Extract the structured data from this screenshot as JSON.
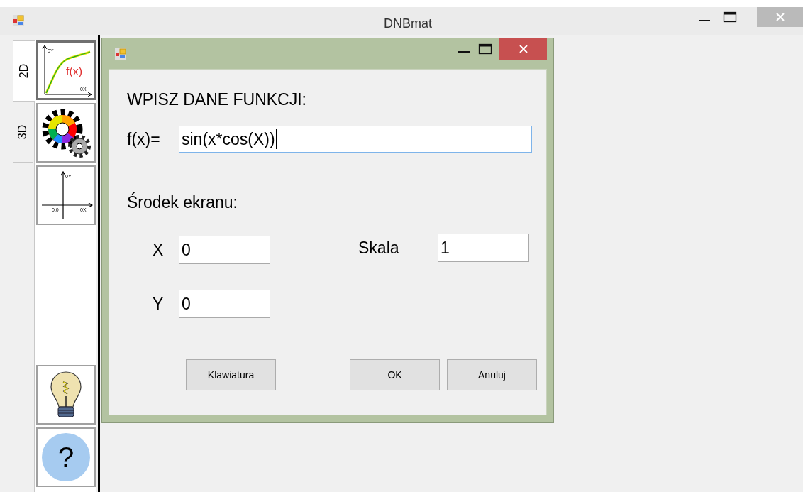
{
  "window": {
    "title": "DNBmat"
  },
  "side_tabs": [
    {
      "label": "2D",
      "selected": true
    },
    {
      "label": "3D",
      "selected": false
    }
  ],
  "tool_buttons": [
    {
      "kind": "graph",
      "selected": true,
      "labels": [
        "0Y",
        "f(x)",
        "0X"
      ]
    },
    {
      "kind": "gears",
      "selected": false
    },
    {
      "kind": "axes",
      "selected": false,
      "labels": [
        "0Y",
        "0,0",
        "0X"
      ]
    },
    {
      "kind": "bulb",
      "selected": false
    },
    {
      "kind": "help",
      "selected": false,
      "labels": [
        "?"
      ]
    }
  ],
  "dialog": {
    "heading": "WPISZ DANE FUNKCJI:",
    "function": {
      "label": "f(x)=",
      "value": "sin(x*cos(X))",
      "focused": true
    },
    "center_heading": "Środek ekranu:",
    "fields": [
      {
        "label": "X",
        "value": "0"
      },
      {
        "label": "Y",
        "value": "0"
      }
    ],
    "scale": {
      "label": "Skala",
      "value": "1"
    },
    "buttons": [
      "Klawiatura",
      "OK",
      "Anuluj"
    ]
  }
}
